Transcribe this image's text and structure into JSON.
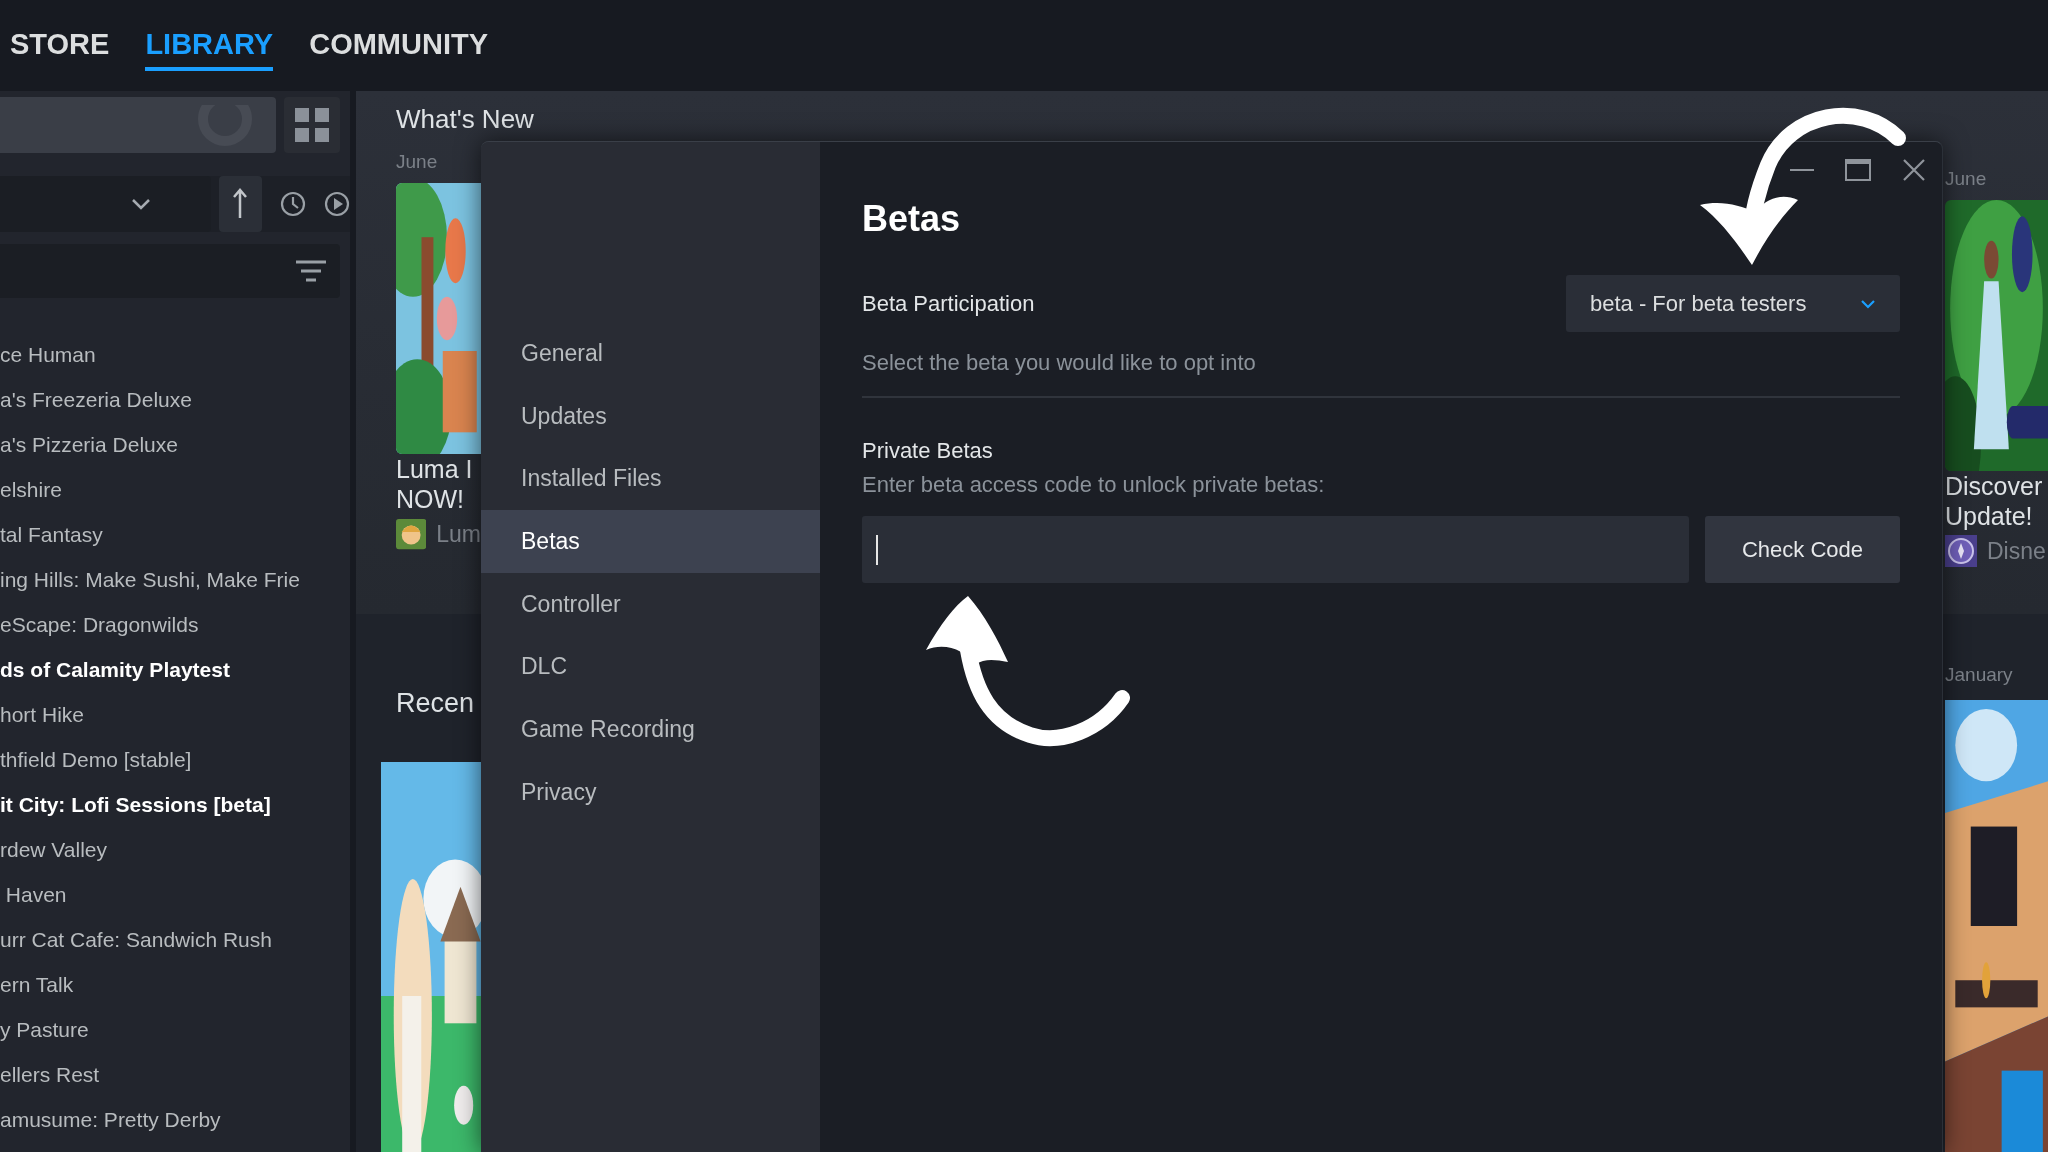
{
  "nav": {
    "tabs": [
      {
        "label": "STORE",
        "selected": false
      },
      {
        "label": "LIBRARY",
        "selected": true
      },
      {
        "label": "COMMUNITY",
        "selected": false
      }
    ]
  },
  "sidebar": {
    "games": [
      {
        "name": "ce Human",
        "highlighted": false
      },
      {
        "name": "a's Freezeria Deluxe",
        "highlighted": false
      },
      {
        "name": "a's Pizzeria Deluxe",
        "highlighted": false
      },
      {
        "name": "elshire",
        "highlighted": false
      },
      {
        "name": "tal Fantasy",
        "highlighted": false
      },
      {
        "name": "ing Hills: Make Sushi, Make Frie",
        "highlighted": false
      },
      {
        "name": "eScape: Dragonwilds",
        "highlighted": false
      },
      {
        "name": "ds of Calamity Playtest",
        "highlighted": true
      },
      {
        "name": "hort Hike",
        "highlighted": false
      },
      {
        "name": "thfield Demo [stable]",
        "highlighted": false
      },
      {
        "name": "it City: Lofi Sessions [beta]",
        "highlighted": true
      },
      {
        "name": "rdew Valley",
        "highlighted": false
      },
      {
        "name": " Haven",
        "highlighted": false
      },
      {
        "name": "urr Cat Cafe: Sandwich Rush",
        "highlighted": false
      },
      {
        "name": "ern Talk",
        "highlighted": false
      },
      {
        "name": "y Pasture",
        "highlighted": false
      },
      {
        "name": "ellers Rest",
        "highlighted": false
      },
      {
        "name": "amusume: Pretty Derby",
        "highlighted": false
      }
    ]
  },
  "whats_new": {
    "title": "What's New",
    "left_card": {
      "date": "June",
      "title_lines": [
        "Luma I",
        "NOW!"
      ],
      "source": "Lum"
    },
    "right_card": {
      "date": "June",
      "title_lines": [
        "Discover",
        "Update!"
      ],
      "source": "Disne"
    }
  },
  "recent": {
    "title": "Recen",
    "right_date": "January"
  },
  "dialog": {
    "nav": [
      {
        "label": "General",
        "selected": false
      },
      {
        "label": "Updates",
        "selected": false
      },
      {
        "label": "Installed Files",
        "selected": false
      },
      {
        "label": "Betas",
        "selected": true
      },
      {
        "label": "Controller",
        "selected": false
      },
      {
        "label": "DLC",
        "selected": false
      },
      {
        "label": "Game Recording",
        "selected": false
      },
      {
        "label": "Privacy",
        "selected": false
      }
    ],
    "title": "Betas",
    "beta_participation": {
      "label": "Beta Participation",
      "value": "beta - For beta testers",
      "description": "Select the beta you would like to opt into"
    },
    "private_betas": {
      "label": "Private Betas",
      "description": "Enter beta access code to unlock private betas:",
      "focused": true,
      "button": "Check Code"
    }
  }
}
